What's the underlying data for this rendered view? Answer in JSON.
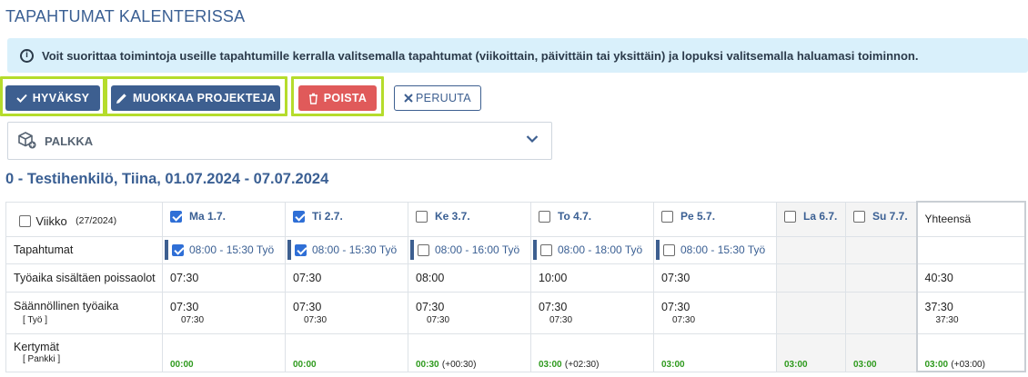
{
  "page_title": "TAPAHTUMAT KALENTERISSA",
  "info_text": "Voit suorittaa toimintoja useille tapahtumille kerralla valitsemalla tapahtumat (viikoittain, päivittäin tai yksittäin) ja lopuksi valitsemalla haluamasi toiminnon.",
  "buttons": {
    "approve": "HYVÄKSY",
    "edit_projects": "MUOKKAA PROJEKTEJA",
    "delete": "POISTA",
    "cancel": "PERUUTA"
  },
  "payroll_label": "PALKKA",
  "person_header": "0 - Testihenkilö, Tiina, 01.07.2024 - 07.07.2024",
  "table": {
    "week_label": "Viikko",
    "week_number": "(27/2024)",
    "total_header": "Yhteensä",
    "days": [
      {
        "label": "Ma 1.7.",
        "checked": true,
        "weekend": false
      },
      {
        "label": "Ti 2.7.",
        "checked": true,
        "weekend": false
      },
      {
        "label": "Ke 3.7.",
        "checked": false,
        "weekend": false
      },
      {
        "label": "To 4.7.",
        "checked": false,
        "weekend": false
      },
      {
        "label": "Pe 5.7.",
        "checked": false,
        "weekend": false
      },
      {
        "label": "La 6.7.",
        "checked": false,
        "weekend": true
      },
      {
        "label": "Su 7.7.",
        "checked": false,
        "weekend": true
      }
    ],
    "rows": {
      "events_label": "Tapahtumat",
      "events": [
        "08:00 - 15:30 Työ",
        "08:00 - 15:30 Työ",
        "08:00 - 16:00 Työ",
        "08:00 - 18:00 Työ",
        "08:00 - 15:30 Työ"
      ],
      "events_checked": [
        true,
        true,
        false,
        false,
        false
      ],
      "work_label": "Työaika sisältäen poissaolot",
      "work": [
        "07:30",
        "07:30",
        "08:00",
        "10:00",
        "07:30"
      ],
      "work_total": "40:30",
      "regular_label": "Säännöllinen työaika",
      "regular_sub": "[ Työ ]",
      "regular": [
        "07:30",
        "07:30",
        "07:30",
        "07:30",
        "07:30"
      ],
      "regular_sub_values": [
        "07:30",
        "07:30",
        "07:30",
        "07:30",
        "07:30"
      ],
      "regular_total": "37:30",
      "regular_total_sub": "37:30",
      "accrual_label": "Kertymät",
      "accrual_sub": "[ Pankki ]",
      "accrual": [
        "00:00",
        "00:00",
        "00:30",
        "03:00",
        "03:00",
        "03:00",
        "03:00"
      ],
      "accrual_delta": [
        "",
        "",
        "(+00:30)",
        "(+02:30)",
        "",
        "",
        ""
      ],
      "accrual_total": "03:00",
      "accrual_total_delta": "(+03:00)"
    }
  }
}
